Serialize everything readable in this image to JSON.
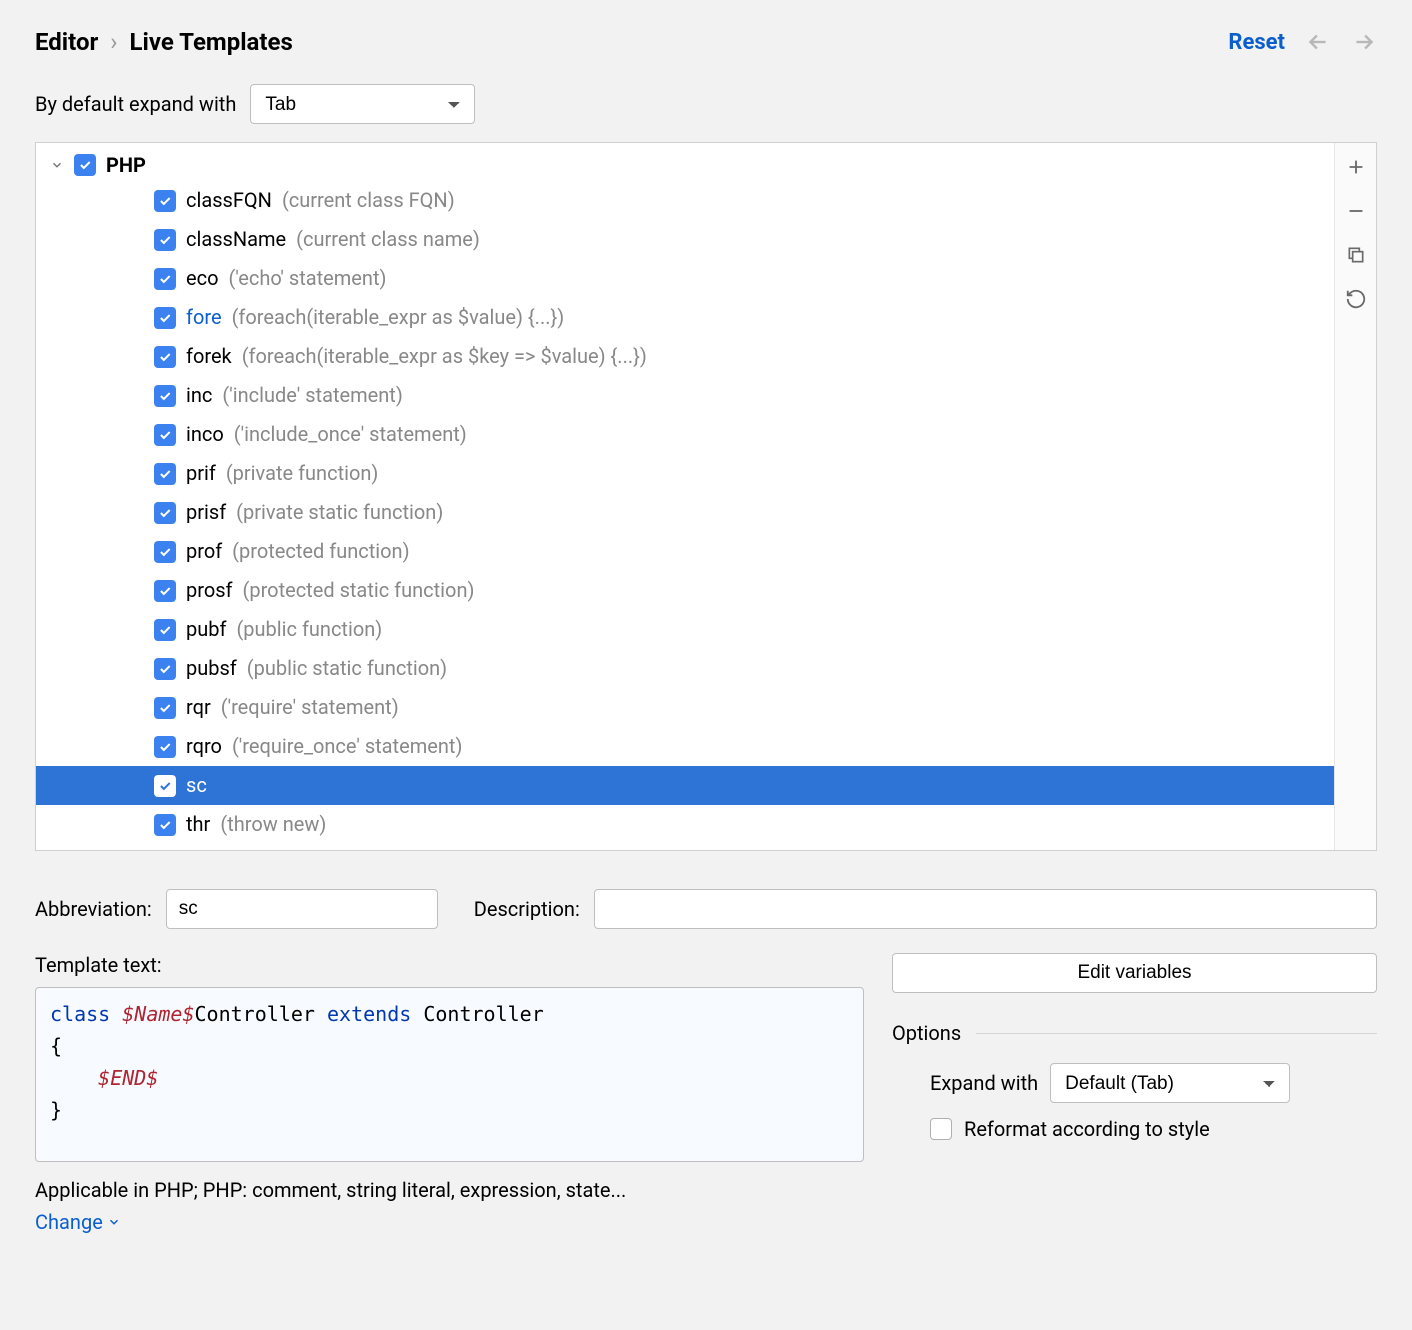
{
  "breadcrumb": {
    "root": "Editor",
    "page": "Live Templates"
  },
  "header": {
    "reset": "Reset"
  },
  "expandDefault": {
    "label": "By default expand with",
    "value": "Tab"
  },
  "group": {
    "name": "PHP",
    "items": [
      {
        "name": "classFQN",
        "desc": "(current class FQN)",
        "checked": true,
        "selected": false,
        "highlight": false
      },
      {
        "name": "className",
        "desc": "(current class name)",
        "checked": true,
        "selected": false,
        "highlight": false
      },
      {
        "name": "eco",
        "desc": "('echo' statement)",
        "checked": true,
        "selected": false,
        "highlight": false
      },
      {
        "name": "fore",
        "desc": "(foreach(iterable_expr as $value) {...})",
        "checked": true,
        "selected": false,
        "highlight": true
      },
      {
        "name": "forek",
        "desc": "(foreach(iterable_expr as $key => $value) {...})",
        "checked": true,
        "selected": false,
        "highlight": false
      },
      {
        "name": "inc",
        "desc": "('include' statement)",
        "checked": true,
        "selected": false,
        "highlight": false
      },
      {
        "name": "inco",
        "desc": "('include_once' statement)",
        "checked": true,
        "selected": false,
        "highlight": false
      },
      {
        "name": "prif",
        "desc": "(private function)",
        "checked": true,
        "selected": false,
        "highlight": false
      },
      {
        "name": "prisf",
        "desc": "(private static function)",
        "checked": true,
        "selected": false,
        "highlight": false
      },
      {
        "name": "prof",
        "desc": "(protected function)",
        "checked": true,
        "selected": false,
        "highlight": false
      },
      {
        "name": "prosf",
        "desc": "(protected static function)",
        "checked": true,
        "selected": false,
        "highlight": false
      },
      {
        "name": "pubf",
        "desc": "(public function)",
        "checked": true,
        "selected": false,
        "highlight": false
      },
      {
        "name": "pubsf",
        "desc": "(public static function)",
        "checked": true,
        "selected": false,
        "highlight": false
      },
      {
        "name": "rqr",
        "desc": "('require' statement)",
        "checked": true,
        "selected": false,
        "highlight": false
      },
      {
        "name": "rqro",
        "desc": "('require_once' statement)",
        "checked": true,
        "selected": false,
        "highlight": false
      },
      {
        "name": "sc",
        "desc": "",
        "checked": true,
        "selected": true,
        "highlight": false
      },
      {
        "name": "thr",
        "desc": "(throw new)",
        "checked": true,
        "selected": false,
        "highlight": false
      }
    ]
  },
  "detail": {
    "abbrevLabel": "Abbreviation:",
    "abbrevValue": "sc",
    "descLabel": "Description:",
    "descValue": "",
    "templateLabel": "Template text:",
    "code": {
      "kw1": "class",
      "var1": "$Name$",
      "mid": "Controller",
      "kw2": "extends",
      "tail": "Controller",
      "open": "{",
      "var2": "$END$",
      "close": "}"
    },
    "editVars": "Edit variables",
    "options": {
      "title": "Options",
      "expandLabel": "Expand with",
      "expandValue": "Default (Tab)",
      "reformat": "Reformat according to style"
    },
    "applicable": "Applicable in PHP; PHP: comment, string literal, expression, state...",
    "change": "Change"
  }
}
